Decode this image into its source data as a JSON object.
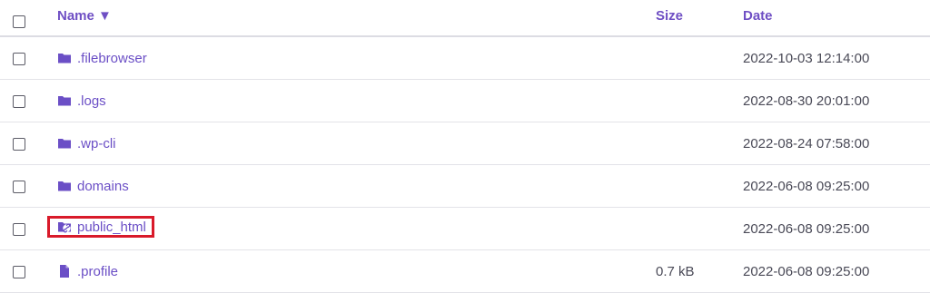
{
  "header": {
    "name_label": "Name ▼",
    "size_label": "Size",
    "date_label": "Date"
  },
  "rows": [
    {
      "name": ".filebrowser",
      "icon": "folder-icon",
      "size": "",
      "date": "2022-10-03 12:14:00"
    },
    {
      "name": ".logs",
      "icon": "folder-icon",
      "size": "",
      "date": "2022-08-30 20:01:00"
    },
    {
      "name": ".wp-cli",
      "icon": "folder-icon",
      "size": "",
      "date": "2022-08-24 07:58:00"
    },
    {
      "name": "domains",
      "icon": "folder-icon",
      "size": "",
      "date": "2022-06-08 09:25:00"
    },
    {
      "name": "public_html",
      "icon": "folder-link-icon",
      "size": "",
      "date": "2022-06-08 09:25:00",
      "highlighted": true
    },
    {
      "name": ".profile",
      "icon": "file-icon",
      "size": "0.7 kB",
      "date": "2022-06-08 09:25:00"
    }
  ],
  "colors": {
    "accent": "#6b4fc6",
    "highlight_border": "#d91a2a"
  }
}
